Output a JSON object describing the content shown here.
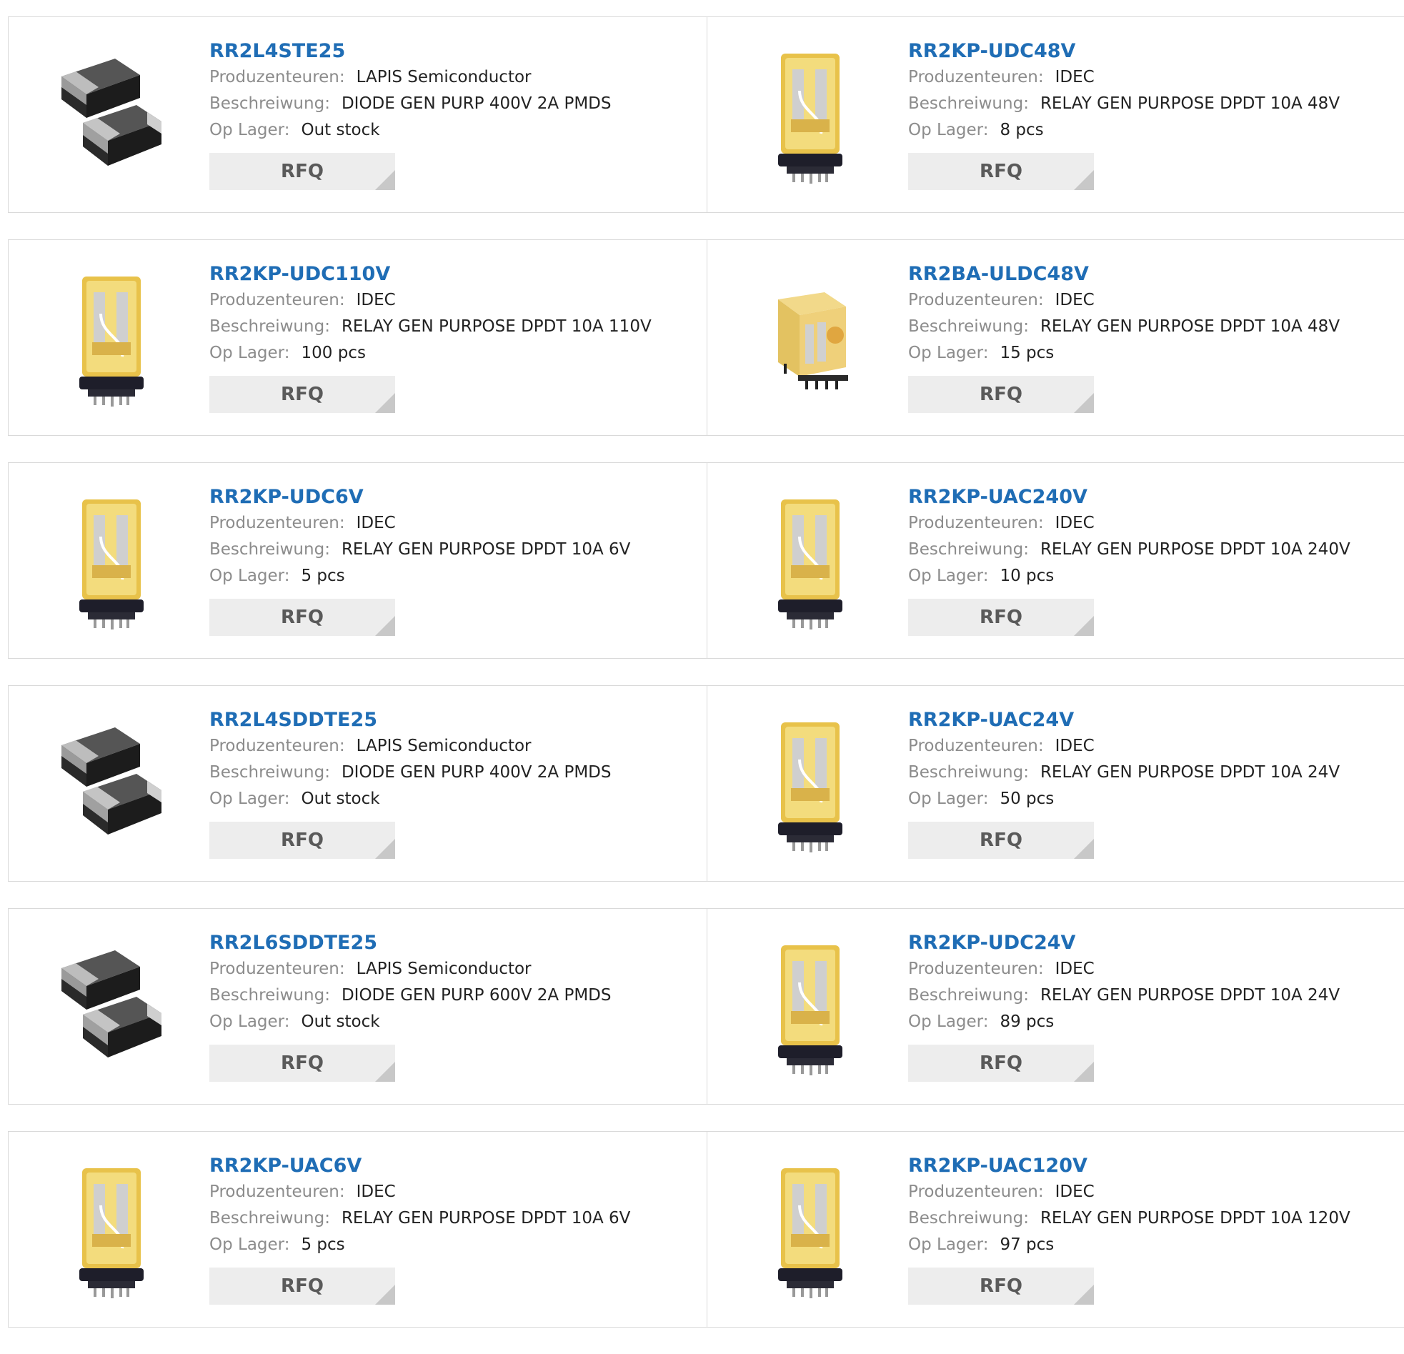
{
  "labels": {
    "manufacturer": "Produzenteuren:",
    "description": "Beschreiwung:",
    "stock": "Op Lager:",
    "rfq": "RFQ"
  },
  "colors": {
    "link": "#1f6db5",
    "label": "#8c8c8c",
    "button_bg": "#ededed"
  },
  "products": [
    {
      "part": "RR2L4STE25",
      "manufacturer": "LAPIS Semiconductor",
      "description": "DIODE GEN PURP 400V 2A PMDS",
      "stock": "Out stock",
      "image": "smd-diode-icon"
    },
    {
      "part": "RR2KP-UDC48V",
      "manufacturer": "IDEC",
      "description": "RELAY GEN PURPOSE DPDT 10A 48V",
      "stock": "8 pcs",
      "image": "relay-icon"
    },
    {
      "part": "RR2KP-UDC110V",
      "manufacturer": "IDEC",
      "description": "RELAY GEN PURPOSE DPDT 10A 110V",
      "stock": "100 pcs",
      "image": "relay-icon"
    },
    {
      "part": "RR2BA-ULDC48V",
      "manufacturer": "IDEC",
      "description": "RELAY GEN PURPOSE DPDT 10A 48V",
      "stock": "15 pcs",
      "image": "cube-relay-icon"
    },
    {
      "part": "RR2KP-UDC6V",
      "manufacturer": "IDEC",
      "description": "RELAY GEN PURPOSE DPDT 10A 6V",
      "stock": "5 pcs",
      "image": "relay-icon"
    },
    {
      "part": "RR2KP-UAC240V",
      "manufacturer": "IDEC",
      "description": "RELAY GEN PURPOSE DPDT 10A 240V",
      "stock": "10 pcs",
      "image": "relay-icon"
    },
    {
      "part": "RR2L4SDDTE25",
      "manufacturer": "LAPIS Semiconductor",
      "description": "DIODE GEN PURP 400V 2A PMDS",
      "stock": "Out stock",
      "image": "smd-diode-icon"
    },
    {
      "part": "RR2KP-UAC24V",
      "manufacturer": "IDEC",
      "description": "RELAY GEN PURPOSE DPDT 10A 24V",
      "stock": "50 pcs",
      "image": "relay-icon"
    },
    {
      "part": "RR2L6SDDTE25",
      "manufacturer": "LAPIS Semiconductor",
      "description": "DIODE GEN PURP 600V 2A PMDS",
      "stock": "Out stock",
      "image": "smd-diode-icon"
    },
    {
      "part": "RR2KP-UDC24V",
      "manufacturer": "IDEC",
      "description": "RELAY GEN PURPOSE DPDT 10A 24V",
      "stock": "89 pcs",
      "image": "relay-icon"
    },
    {
      "part": "RR2KP-UAC6V",
      "manufacturer": "IDEC",
      "description": "RELAY GEN PURPOSE DPDT 10A 6V",
      "stock": "5 pcs",
      "image": "relay-icon"
    },
    {
      "part": "RR2KP-UAC120V",
      "manufacturer": "IDEC",
      "description": "RELAY GEN PURPOSE DPDT 10A 120V",
      "stock": "97 pcs",
      "image": "relay-icon"
    }
  ]
}
